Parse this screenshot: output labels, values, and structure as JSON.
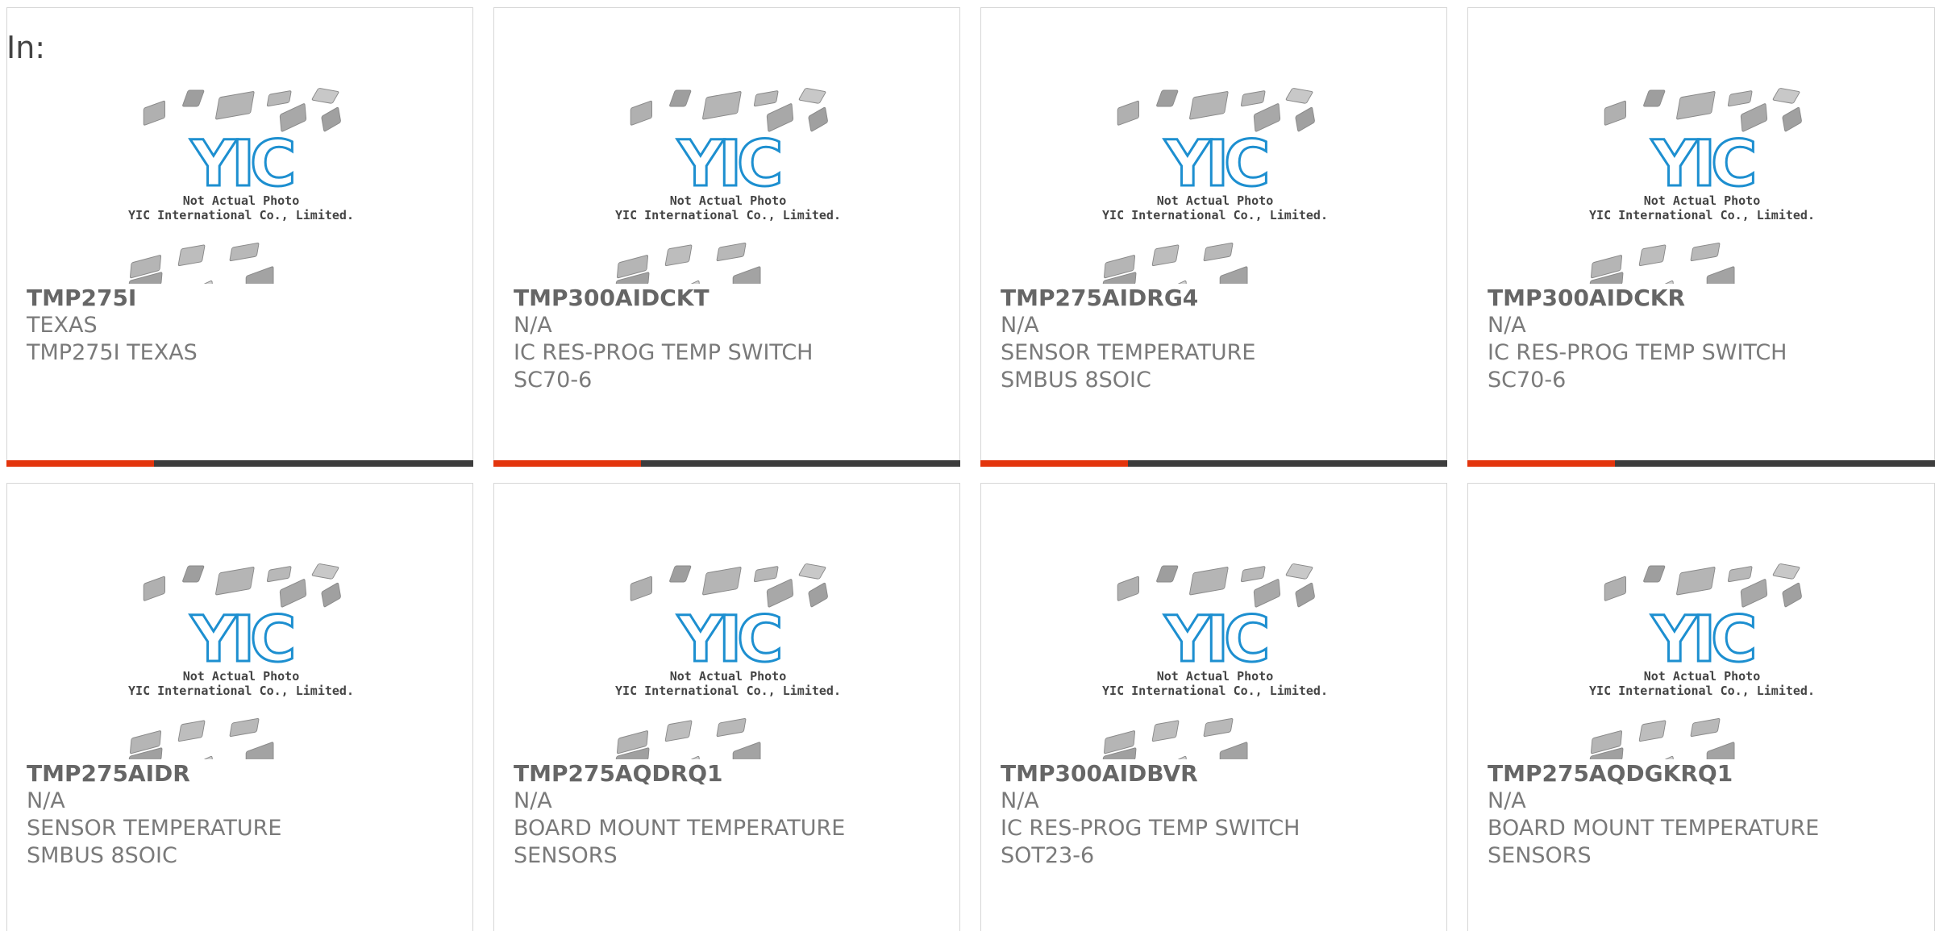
{
  "header": {
    "in_label": "In:"
  },
  "photo": {
    "logo_text": "YIC",
    "line1": "Not Actual Photo",
    "line2": "YIC International Co., Limited."
  },
  "colors": {
    "accent": "#e3350d",
    "bar": "#3d3d3d",
    "logo": "#1d8fd0"
  },
  "products": [
    {
      "part": "TMP275I",
      "brand": "TEXAS",
      "desc": "TMP275I TEXAS"
    },
    {
      "part": "TMP300AIDCKT",
      "brand": "N/A",
      "desc": "IC RES-PROG TEMP SWITCH SC70-6"
    },
    {
      "part": "TMP275AIDRG4",
      "brand": "N/A",
      "desc": "SENSOR TEMPERATURE SMBUS 8SOIC"
    },
    {
      "part": "TMP300AIDCKR",
      "brand": "N/A",
      "desc": "IC RES-PROG TEMP SWITCH SC70-6"
    },
    {
      "part": "TMP275AIDR",
      "brand": "N/A",
      "desc": "SENSOR TEMPERATURE SMBUS 8SOIC"
    },
    {
      "part": "TMP275AQDRQ1",
      "brand": "N/A",
      "desc": "BOARD MOUNT TEMPERATURE SENSORS"
    },
    {
      "part": "TMP300AIDBVR",
      "brand": "N/A",
      "desc": "IC RES-PROG TEMP SWITCH SOT23-6"
    },
    {
      "part": "TMP275AQDGKRQ1",
      "brand": "N/A",
      "desc": "BOARD MOUNT TEMPERATURE SENSORS"
    }
  ]
}
